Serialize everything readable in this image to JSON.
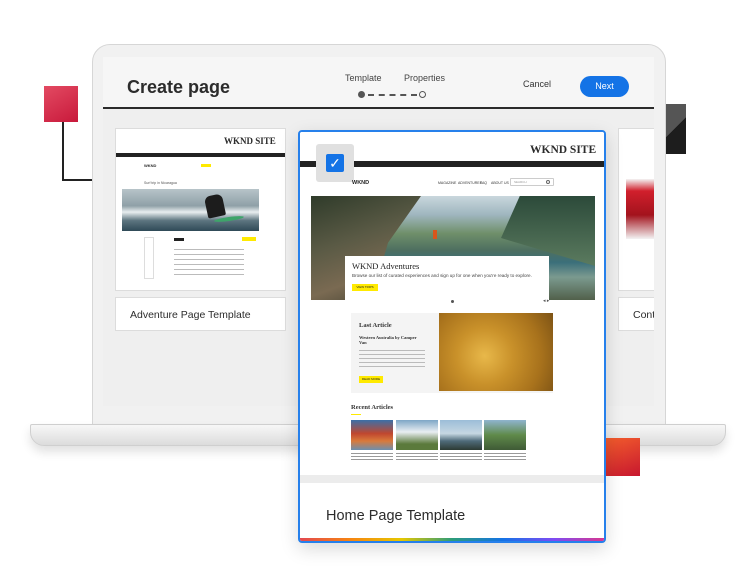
{
  "create_page": {
    "title": "Create page",
    "steps": [
      "Template",
      "Properties"
    ],
    "cancel_label": "Cancel",
    "next_label": "Next"
  },
  "templates": [
    {
      "name": "Adventure Page Template",
      "site_title": "WKND SITE",
      "logo": "WKND",
      "heading": "Surf trip in Nicaragua"
    },
    {
      "name": "Home Page Template",
      "site_title": "WKND SITE",
      "selected": true
    },
    {
      "name": "Cont"
    }
  ],
  "home_preview": {
    "logo": "WKND",
    "nav": [
      "MAGAZINE",
      "ADVENTURES",
      "FAQ",
      "ABOUT US"
    ],
    "search_placeholder": "SEARCH",
    "hero_title": "WKND Adventures",
    "hero_text": "Browse our list of curated experiences and sign up for one when you're ready to explore.",
    "hero_button": "VIEW TRIPS",
    "last_article_label": "Last Article",
    "last_article_title": "Western Australia by Camper Van",
    "last_article_button": "READ MORE",
    "recent_articles_label": "Recent Articles"
  },
  "colors": {
    "accent": "#1473e6",
    "selected_border": "#2680eb",
    "wknd_yellow": "#ffea00"
  },
  "icons": [
    "checkmark-icon",
    "search-icon"
  ]
}
